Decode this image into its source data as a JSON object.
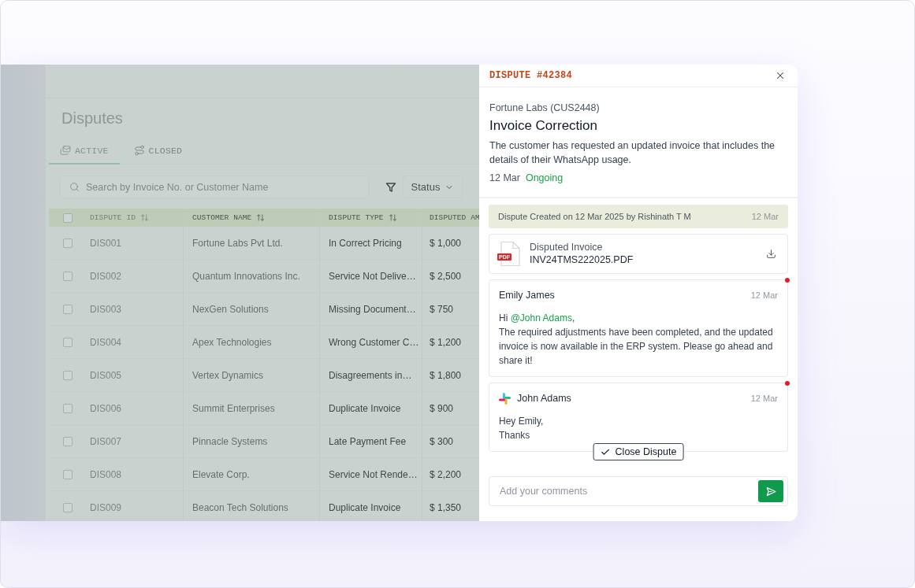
{
  "app": {
    "title": "Disputes",
    "tabs": [
      {
        "label": "ACTIVE",
        "selected": true
      },
      {
        "label": "CLOSED",
        "selected": false
      }
    ],
    "search": {
      "placeholder": "Search by Invoice No. or Customer Name"
    },
    "filter_button": {
      "label": "Status"
    },
    "table": {
      "select_all": {
        "checked": false
      },
      "columns": [
        {
          "label": "DISPUTE ID",
          "sortable": true
        },
        {
          "label": "CUSTOMER NAME",
          "sortable": true
        },
        {
          "label": "DISPUTE TYPE",
          "sortable": true
        },
        {
          "label": "DISPUTED AM",
          "sortable": false
        }
      ],
      "rows": [
        {
          "checked": false,
          "cells": [
            "DIS001",
            "Fortune Labs Pvt Ltd.",
            "In Correct Pricing",
            "$ 1,000"
          ]
        },
        {
          "checked": false,
          "cells": [
            "DIS002",
            "Quantum Innovations Inc.",
            "Service Not Delive…",
            "$ 2,500"
          ]
        },
        {
          "checked": false,
          "cells": [
            "DIS003",
            "NexGen Solutions",
            "Missing Document…",
            "$ 750"
          ]
        },
        {
          "checked": false,
          "cells": [
            "DIS004",
            "Apex Technologies",
            "Wrong Customer C…",
            "$ 1,200"
          ]
        },
        {
          "checked": false,
          "cells": [
            "DIS005",
            "Vertex Dynamics",
            "Disagreements in…",
            "$ 1,800"
          ]
        },
        {
          "checked": false,
          "cells": [
            "DIS006",
            "Summit Enterprises",
            "Duplicate Invoice",
            "$ 900"
          ]
        },
        {
          "checked": false,
          "cells": [
            "DIS007",
            "Pinnacle Systems",
            "Late Payment Fee",
            "$ 300"
          ]
        },
        {
          "checked": false,
          "cells": [
            "DIS008",
            "Elevate Corp.",
            "Service Not Rende…",
            "$ 2,200"
          ]
        },
        {
          "checked": false,
          "cells": [
            "DIS009",
            "Beacon Tech Solutions",
            "Duplicate Invoice",
            "$ 1,350"
          ]
        }
      ]
    }
  },
  "drawer": {
    "title": "DISPUTE #42384",
    "customer": "Fortune Labs (CUS2448)",
    "heading": "Invoice Correction",
    "description": "The customer has requested an updated invoice that includes the details of their WhatsApp usage.",
    "date": "12 Mar",
    "status": "Ongoing",
    "timeline": [
      {
        "kind": "event",
        "text": "Dispute Created on 12 Mar 2025 by Rishinath T M",
        "date": "12 Mar"
      },
      {
        "kind": "attachment",
        "title": "Disputed Invoice",
        "file": "INV24TMS222025.PDF",
        "file_type": "PDF"
      },
      {
        "kind": "comment",
        "author": "Emily James",
        "date": "12 Mar",
        "unread": true,
        "external": false,
        "body": [
          {
            "segments": [
              {
                "kind": "text",
                "text": "Hi "
              },
              {
                "kind": "mention",
                "text": "@John Adams"
              },
              {
                "kind": "text",
                "text": ","
              }
            ]
          },
          {
            "segments": [
              {
                "kind": "text",
                "text": "The required adjustments have been completed, and the updated invoice is now available in the ERP system. Please go ahead and share it!"
              }
            ]
          }
        ]
      },
      {
        "kind": "comment",
        "author": "John Adams",
        "date": "12 Mar",
        "unread": true,
        "external": true,
        "body": [
          {
            "segments": [
              {
                "kind": "text",
                "text": "Hey Emily,"
              }
            ]
          },
          {
            "segments": [
              {
                "kind": "text",
                "text": "Thanks"
              }
            ]
          }
        ]
      }
    ],
    "close_button": {
      "label": "Close Dispute"
    },
    "comment_input": {
      "placeholder": "Add your comments"
    }
  }
}
